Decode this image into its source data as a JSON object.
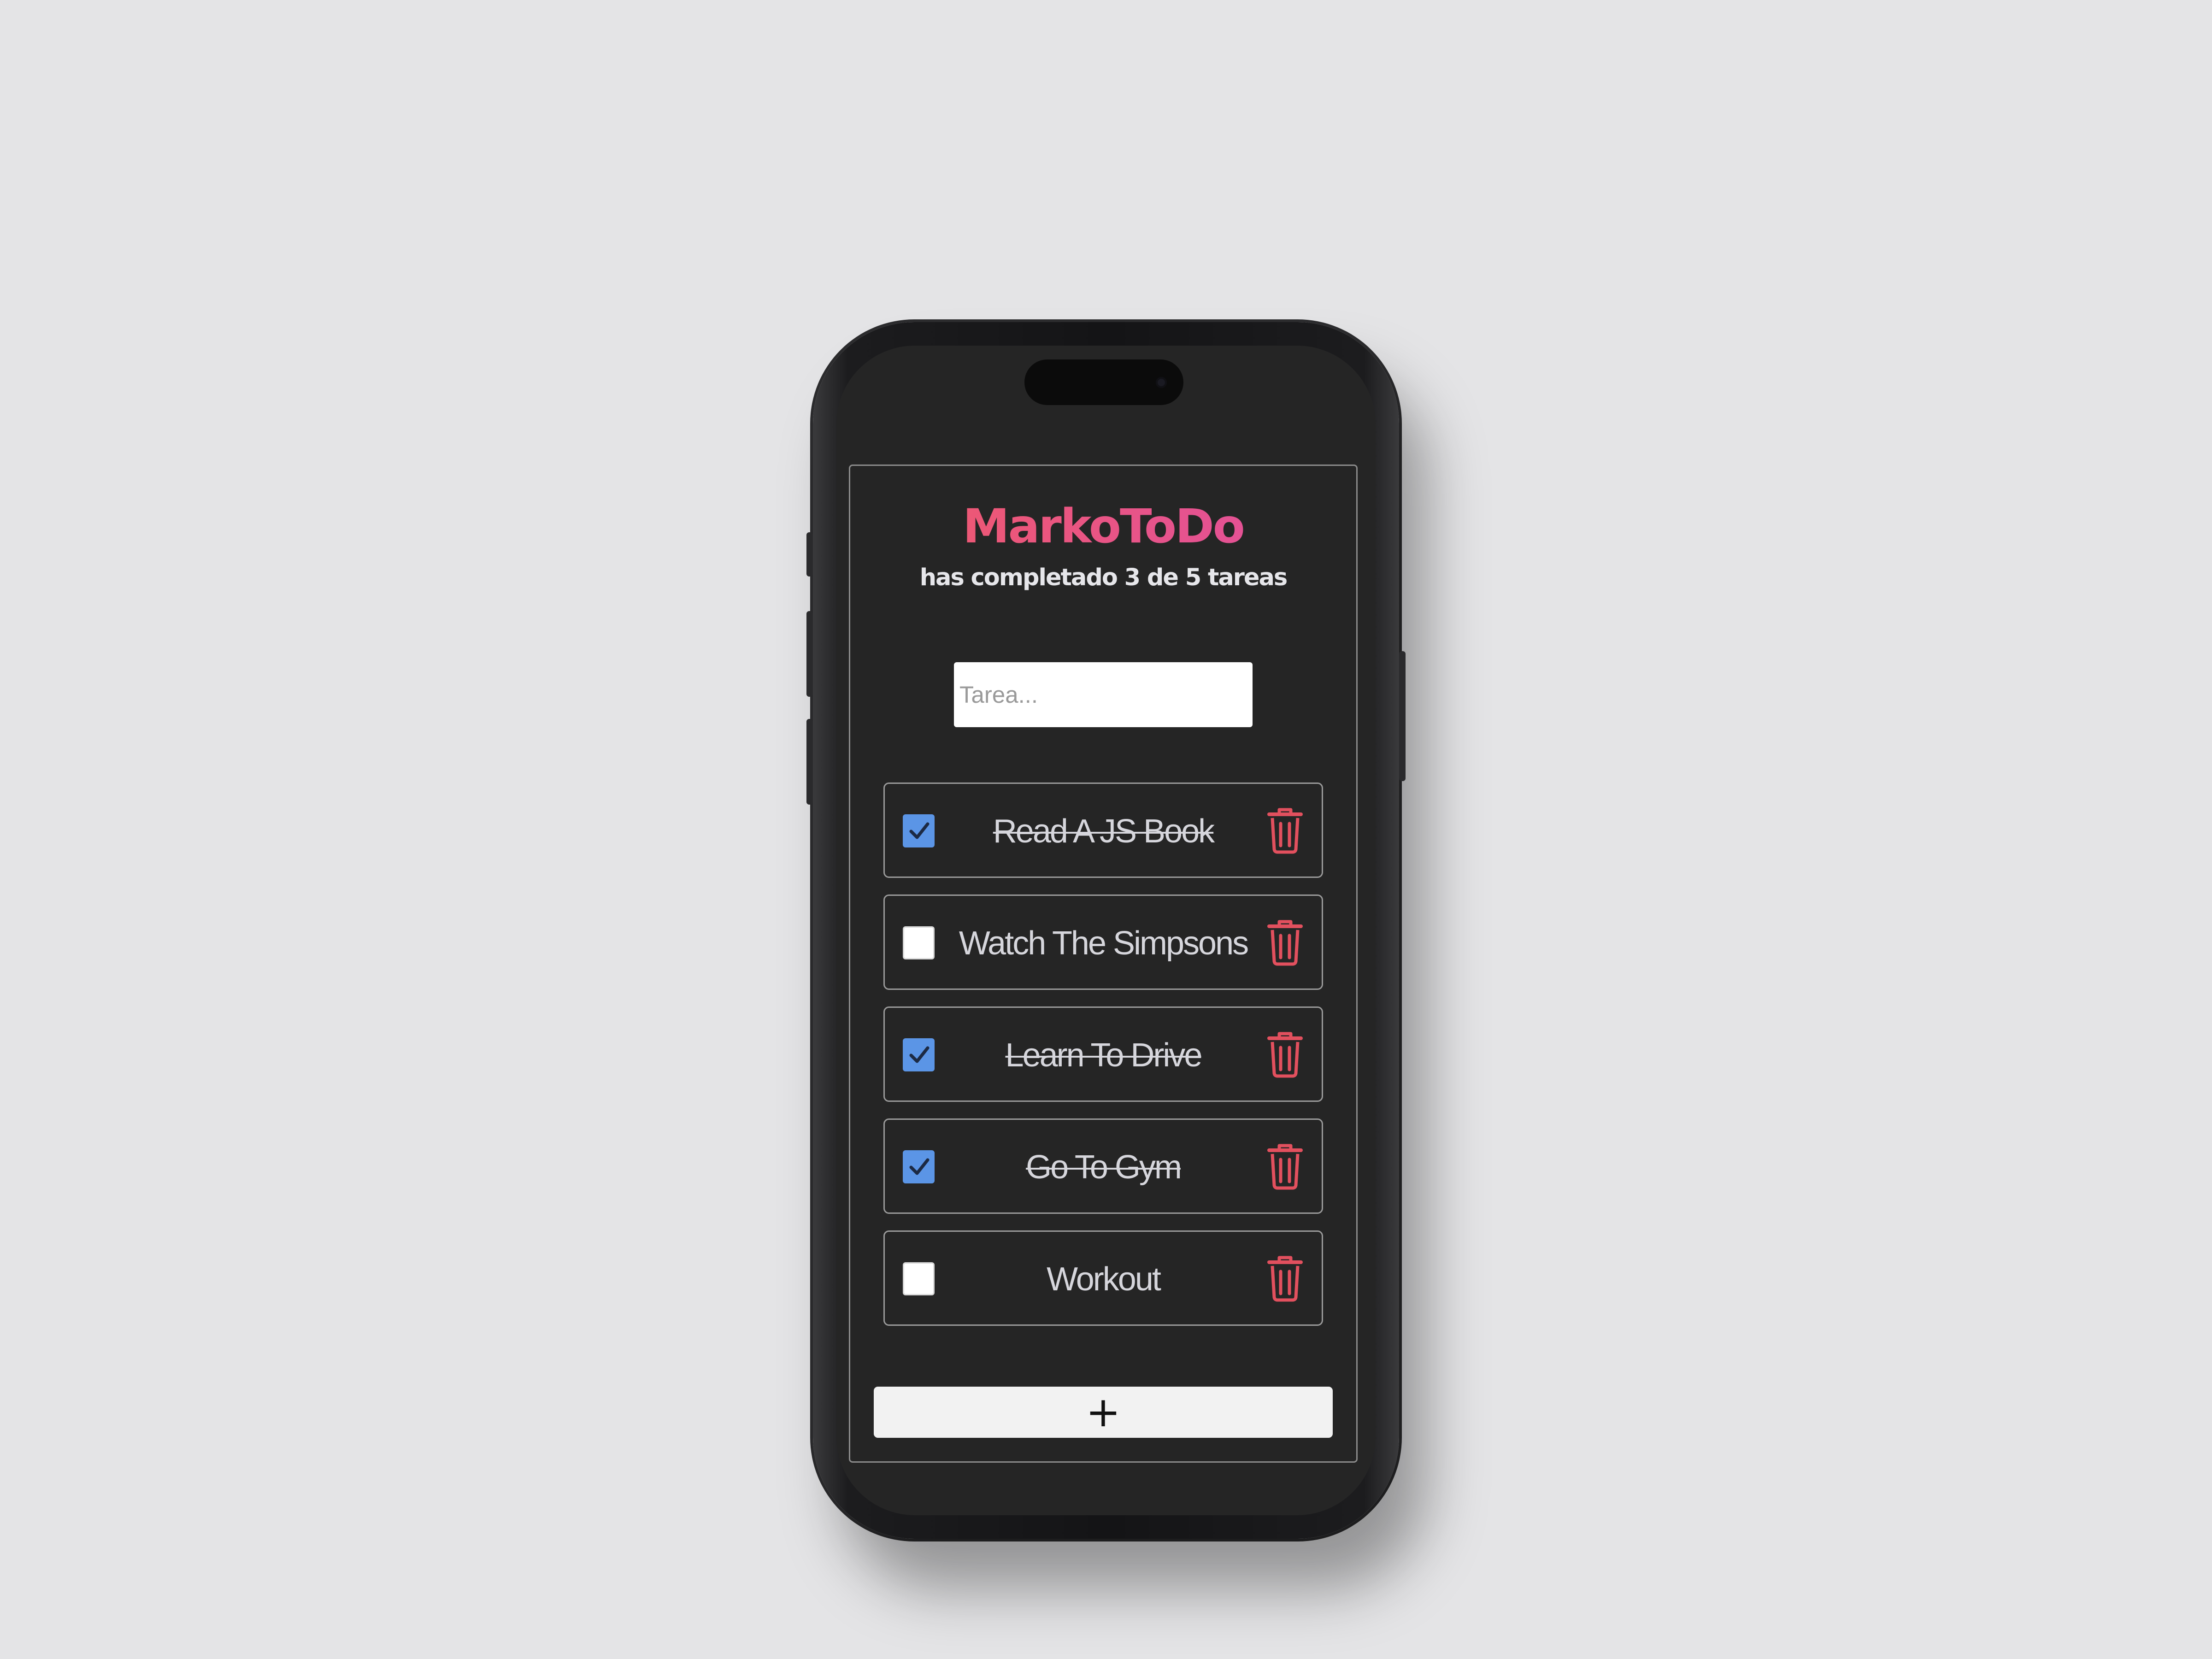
{
  "app": {
    "title": "MarkoToDo",
    "subtitle": "has completado 3 de 5 tareas"
  },
  "input": {
    "placeholder": "Tarea...",
    "value": ""
  },
  "todos": [
    {
      "label": "Read A JS Book",
      "completed": true
    },
    {
      "label": "Watch The Simpsons",
      "completed": false
    },
    {
      "label": "Learn To Drive",
      "completed": true
    },
    {
      "label": "Go To Gym",
      "completed": true
    },
    {
      "label": "Workout",
      "completed": false
    }
  ],
  "add_button": {
    "label": "+"
  },
  "icons": {
    "checkbox": "checkbox-icon",
    "delete": "trash-icon"
  },
  "colors": {
    "page_background": "#e4e4e6",
    "screen_background": "#252525",
    "title_gradient_start": "#f05a6a",
    "title_gradient_end": "#e04fa0",
    "checkbox_checked": "#5b95e6",
    "delete_icon": "#e2505e",
    "text_light": "#d6d6dc"
  }
}
